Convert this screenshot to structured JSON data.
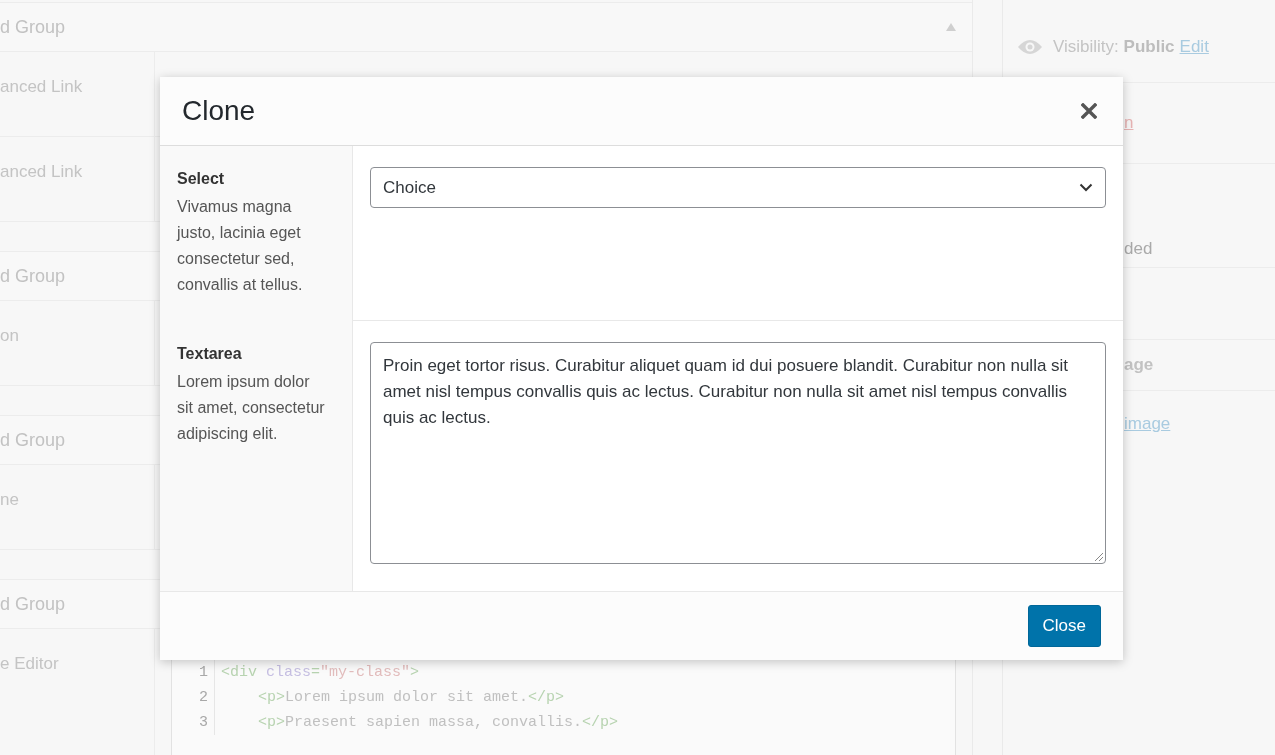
{
  "background": {
    "groups": [
      {
        "title": "d Group",
        "collapsible": true,
        "fields": [
          {
            "label": "anced Link"
          },
          {
            "label": "anced Link"
          }
        ]
      },
      {
        "title": "d Group",
        "collapsible": false,
        "fields": [
          {
            "label": "on"
          }
        ]
      },
      {
        "title": "d Group",
        "collapsible": false,
        "fields": [
          {
            "label": "ne"
          }
        ]
      },
      {
        "title": "d Group",
        "collapsible": false,
        "fields": [
          {
            "label": "e Editor",
            "code_lines": [
              {
                "number": "1",
                "indented": false,
                "tokens": [
                  {
                    "kind": "tag",
                    "text": "<div "
                  },
                  {
                    "kind": "attr",
                    "text": "class"
                  },
                  {
                    "kind": "tag",
                    "text": "="
                  },
                  {
                    "kind": "string",
                    "text": "\"my-class\""
                  },
                  {
                    "kind": "tag",
                    "text": ">"
                  }
                ]
              },
              {
                "number": "2",
                "indented": true,
                "tokens": [
                  {
                    "kind": "tag",
                    "text": "<p>"
                  },
                  {
                    "kind": "text",
                    "text": "Lorem ipsum dolor sit amet."
                  },
                  {
                    "kind": "tag",
                    "text": "</p>"
                  }
                ]
              },
              {
                "number": "3",
                "indented": true,
                "tokens": [
                  {
                    "kind": "tag",
                    "text": "<p>"
                  },
                  {
                    "kind": "text",
                    "text": "Praesent sapien massa, convallis."
                  },
                  {
                    "kind": "tag",
                    "text": "</p>"
                  }
                ]
              }
            ]
          }
        ]
      }
    ],
    "sidebar": [
      {
        "kind": "visibility",
        "label": "Visibility:",
        "value": "Public",
        "link": "Edit"
      },
      {
        "kind": "danger-link",
        "text": "n"
      },
      {
        "kind": "field",
        "text": "ded"
      },
      {
        "kind": "heading",
        "text": "age"
      },
      {
        "kind": "link",
        "text": "image"
      }
    ]
  },
  "modal": {
    "title": "Clone",
    "fields": [
      {
        "kind": "select",
        "label": "Select",
        "description": "Vivamus magna justo, lacinia eget consectetur sed, convallis at tellus.",
        "value": "Choice"
      },
      {
        "kind": "textarea",
        "label": "Textarea",
        "description": "Lorem ipsum dolor sit amet, consectetur adipiscing elit.",
        "value": "Proin eget tortor risus. Curabitur aliquet quam id dui posuere blandit. Curabitur non nulla sit amet nisl tempus convallis quis ac lectus. Curabitur non nulla sit amet nisl tempus convallis quis ac lectus."
      }
    ],
    "buttons": [
      "Close"
    ]
  }
}
